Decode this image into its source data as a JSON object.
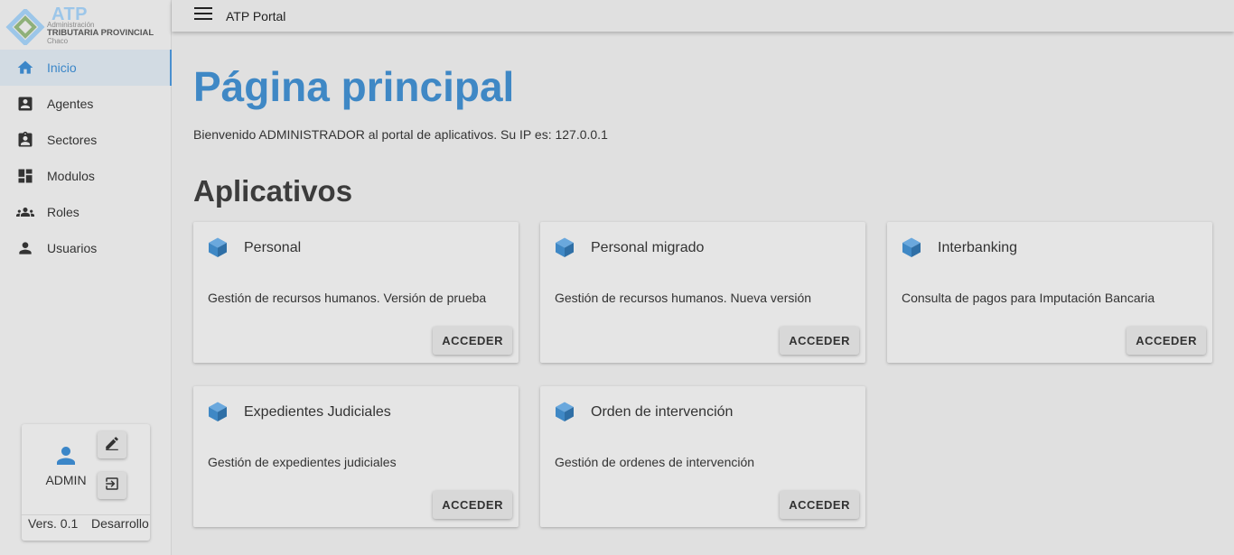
{
  "logo": {
    "big": "ATP",
    "line1": "Administración",
    "line2": "TRIBUTARIA PROVINCIAL",
    "line3": "Chaco"
  },
  "topbar": {
    "title": "ATP Portal"
  },
  "sidebar": {
    "items": [
      {
        "label": "Inicio",
        "icon": "home-icon",
        "active": true
      },
      {
        "label": "Agentes",
        "icon": "account-box-icon"
      },
      {
        "label": "Sectores",
        "icon": "assignment-ind-icon"
      },
      {
        "label": "Modulos",
        "icon": "dashboard-icon"
      },
      {
        "label": "Roles",
        "icon": "groups-icon"
      },
      {
        "label": "Usuarios",
        "icon": "person-icon"
      }
    ]
  },
  "user": {
    "name": "ADMIN",
    "version": "Vers. 0.1",
    "environment": "Desarrollo"
  },
  "main": {
    "title": "Página principal",
    "welcome": "Bienvenido ADMINISTRADOR al portal de aplicativos. Su IP es: 127.0.0.1",
    "apps_heading": "Aplicativos",
    "apps": [
      {
        "title": "Personal",
        "description": "Gestión de recursos humanos. Versión de prueba",
        "button": "ACCEDER"
      },
      {
        "title": "Personal migrado",
        "description": "Gestión de recursos humanos. Nueva versión",
        "button": "ACCEDER"
      },
      {
        "title": "Interbanking",
        "description": "Consulta de pagos para Imputación Bancaria",
        "button": "ACCEDER"
      },
      {
        "title": "Expedientes Judiciales",
        "description": "Gestión de expedientes judiciales",
        "button": "ACCEDER"
      },
      {
        "title": "Orden de intervención",
        "description": "Gestión de ordenes de intervención",
        "button": "ACCEDER"
      }
    ]
  },
  "colors": {
    "accent": "#3f88c5",
    "background": "#e0e0e0",
    "cube": "#4a90d0"
  }
}
